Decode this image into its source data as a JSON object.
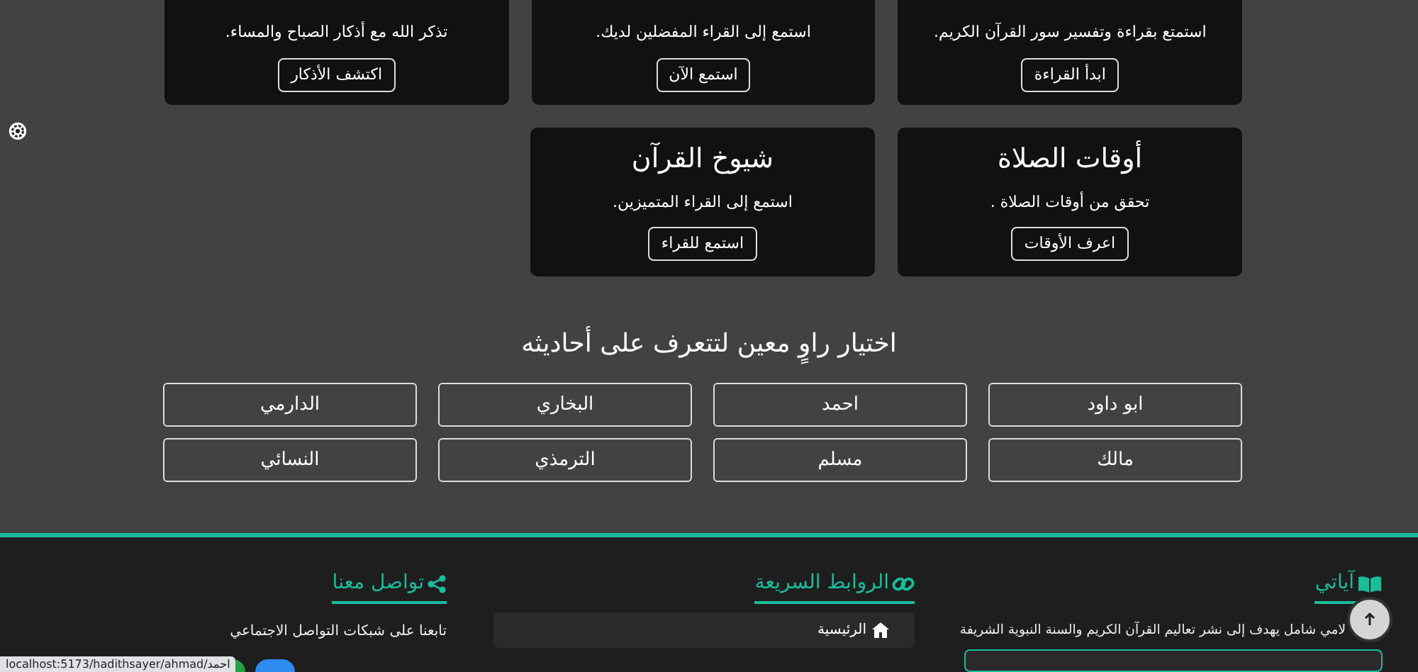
{
  "top_cards": [
    {
      "description": "استمتع بقراءة وتفسير سور القرآن الكريم.",
      "button": "ابدأ القراءة"
    },
    {
      "description": "استمع إلى القراء المفضلين لديك.",
      "button": "استمع الآن"
    },
    {
      "description": "تذكر الله مع أذكار الصباح والمساء.",
      "button": "اكتشف الأذكار"
    }
  ],
  "cards": [
    {
      "title": "أوقات الصلاة",
      "description": "تحقق من أوقات الصلاة .",
      "button": "اعرف الأوقات"
    },
    {
      "title": "شيوخ القرآن",
      "description": "استمع إلى القراء المتميزين.",
      "button": "استمع للقراء"
    }
  ],
  "narrators": {
    "heading": "اختيار راوٍ معين لتتعرف على أحاديثه",
    "items": [
      "ابو داود",
      "احمد",
      "البخاري",
      "الدارمي",
      "مالك",
      "مسلم",
      "الترمذي",
      "النسائي"
    ]
  },
  "footer": {
    "about": {
      "title": "آياتي",
      "text": "لامي شامل يهدف إلى نشر تعاليم القرآن الكريم والسنة النبوية الشريفة"
    },
    "links": {
      "title": "الروابط السريعة",
      "items": [
        "الرئيسية"
      ]
    },
    "contact": {
      "title": "تواصل معنا",
      "text": "تابعنا على شبكات التواصل الاجتماعي"
    }
  },
  "status_url": "localhost:5173/hadithsayer/ahmad/احمد"
}
